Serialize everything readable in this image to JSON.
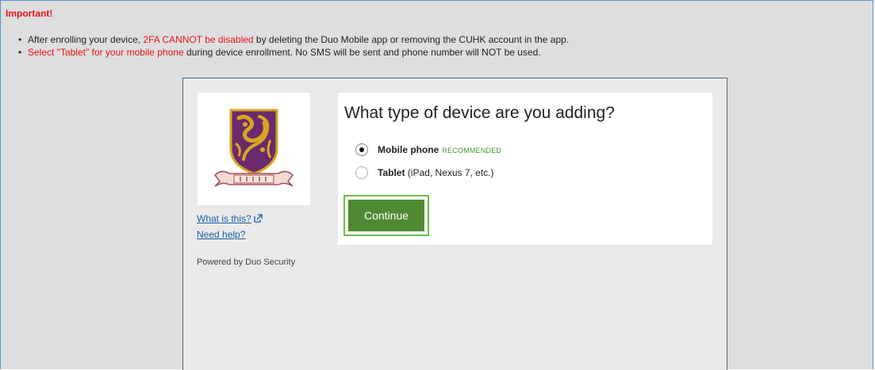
{
  "notice": {
    "title": "Important!",
    "items": [
      {
        "bullet": "•",
        "part1": "After enrolling your device, ",
        "part2_red": "2FA CANNOT be disabled",
        "part3": " by deleting the Duo Mobile app or removing the CUHK account in the app."
      },
      {
        "bullet": "•",
        "part1_red": "Select \"Tablet\" for your mobile phone",
        "part2": " during device enrollment. No SMS will be sent and phone number will NOT be used."
      }
    ]
  },
  "sidebar": {
    "logo": "cuhk-crest-logo",
    "what_is_this": "What is this?",
    "need_help": "Need help?",
    "powered_by": "Powered by Duo Security"
  },
  "panel": {
    "title": "What type of device are you adding?",
    "options": [
      {
        "label": "Mobile phone",
        "tag": "RECOMMENDED",
        "checked": true
      },
      {
        "label": "Tablet",
        "detail": "(iPad, Nexus 7, etc.)",
        "checked": false
      }
    ],
    "continue_label": "Continue"
  },
  "colors": {
    "accent_red": "#e8131a",
    "button_green": "#4f8a33",
    "focus_green": "#6abf4b",
    "link_blue": "#1a5fa8",
    "crest_purple": "#6b2a6e",
    "crest_gold": "#d9a61d"
  }
}
